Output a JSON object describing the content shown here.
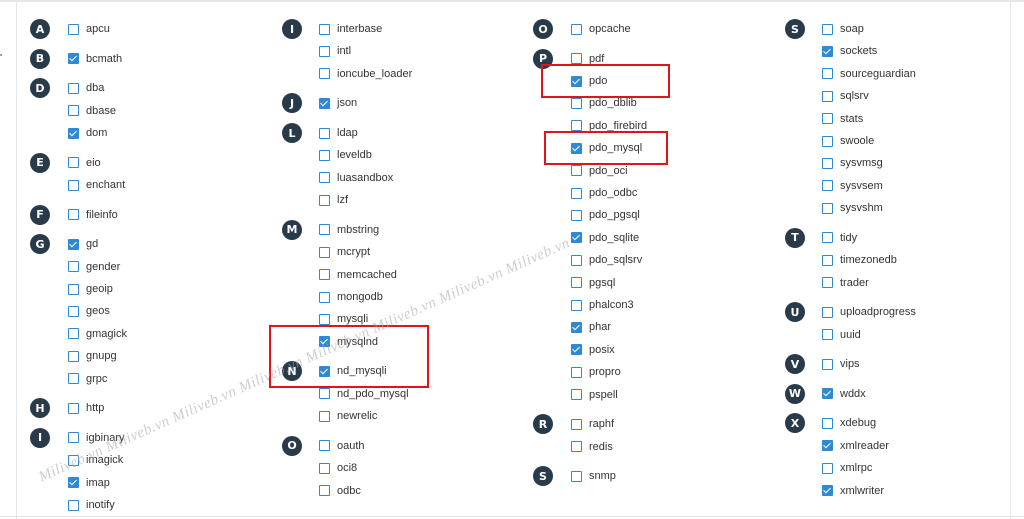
{
  "columns": [
    {
      "groups": [
        {
          "letter": "A",
          "items": [
            {
              "label": "apcu",
              "checked": false
            }
          ]
        },
        {
          "letter": "B",
          "items": [
            {
              "label": "bcmath",
              "checked": true
            }
          ]
        },
        {
          "letter": "D",
          "items": [
            {
              "label": "dba",
              "checked": false
            },
            {
              "label": "dbase",
              "checked": false
            },
            {
              "label": "dom",
              "checked": true
            }
          ]
        },
        {
          "letter": "E",
          "items": [
            {
              "label": "eio",
              "checked": false
            },
            {
              "label": "enchant",
              "checked": false
            }
          ]
        },
        {
          "letter": "F",
          "items": [
            {
              "label": "fileinfo",
              "checked": false
            }
          ]
        },
        {
          "letter": "G",
          "items": [
            {
              "label": "gd",
              "checked": true
            },
            {
              "label": "gender",
              "checked": false
            },
            {
              "label": "geoip",
              "checked": false
            },
            {
              "label": "geos",
              "checked": false
            },
            {
              "label": "gmagick",
              "checked": false
            },
            {
              "label": "gnupg",
              "checked": false
            },
            {
              "label": "grpc",
              "checked": false
            }
          ]
        },
        {
          "letter": "H",
          "items": [
            {
              "label": "http",
              "checked": false
            }
          ]
        },
        {
          "letter": "I",
          "items": [
            {
              "label": "igbinary",
              "checked": false
            },
            {
              "label": "imagick",
              "checked": false
            },
            {
              "label": "imap",
              "checked": true
            },
            {
              "label": "inotify",
              "checked": false
            }
          ]
        }
      ]
    },
    {
      "groups": [
        {
          "letter": "I",
          "items": [
            {
              "label": "interbase",
              "checked": false
            },
            {
              "label": "intl",
              "checked": false
            },
            {
              "label": "ioncube_loader",
              "checked": false
            }
          ]
        },
        {
          "letter": "J",
          "items": [
            {
              "label": "json",
              "checked": true
            }
          ]
        },
        {
          "letter": "L",
          "items": [
            {
              "label": "ldap",
              "checked": false
            },
            {
              "label": "leveldb",
              "checked": false
            },
            {
              "label": "luasandbox",
              "checked": false
            },
            {
              "label": "lzf",
              "checked": false
            }
          ]
        },
        {
          "letter": "M",
          "items": [
            {
              "label": "mbstring",
              "checked": false
            },
            {
              "label": "mcrypt",
              "checked": false
            },
            {
              "label": "memcached",
              "checked": false
            },
            {
              "label": "mongodb",
              "checked": false
            },
            {
              "label": "mysqli",
              "checked": false
            },
            {
              "label": "mysqlnd",
              "checked": true
            }
          ]
        },
        {
          "letter": "N",
          "items": [
            {
              "label": "nd_mysqli",
              "checked": true
            },
            {
              "label": "nd_pdo_mysql",
              "checked": false
            },
            {
              "label": "newrelic",
              "checked": false
            }
          ]
        },
        {
          "letter": "O",
          "items": [
            {
              "label": "oauth",
              "checked": false
            },
            {
              "label": "oci8",
              "checked": false
            },
            {
              "label": "odbc",
              "checked": false
            }
          ]
        }
      ]
    },
    {
      "groups": [
        {
          "letter": "O",
          "items": [
            {
              "label": "opcache",
              "checked": false
            }
          ]
        },
        {
          "letter": "P",
          "items": [
            {
              "label": "pdf",
              "checked": false
            },
            {
              "label": "pdo",
              "checked": true
            },
            {
              "label": "pdo_dblib",
              "checked": false
            },
            {
              "label": "pdo_firebird",
              "checked": false
            },
            {
              "label": "pdo_mysql",
              "checked": true
            },
            {
              "label": "pdo_oci",
              "checked": false
            },
            {
              "label": "pdo_odbc",
              "checked": false
            },
            {
              "label": "pdo_pgsql",
              "checked": false
            },
            {
              "label": "pdo_sqlite",
              "checked": true
            },
            {
              "label": "pdo_sqlsrv",
              "checked": false
            },
            {
              "label": "pgsql",
              "checked": false
            },
            {
              "label": "phalcon3",
              "checked": false
            },
            {
              "label": "phar",
              "checked": true
            },
            {
              "label": "posix",
              "checked": true
            },
            {
              "label": "propro",
              "checked": false
            },
            {
              "label": "pspell",
              "checked": false
            }
          ]
        },
        {
          "letter": "R",
          "items": [
            {
              "label": "raphf",
              "checked": false
            },
            {
              "label": "redis",
              "checked": false
            }
          ]
        },
        {
          "letter": "S",
          "items": [
            {
              "label": "snmp",
              "checked": false
            }
          ]
        }
      ]
    },
    {
      "groups": [
        {
          "letter": "S",
          "items": [
            {
              "label": "soap",
              "checked": false
            },
            {
              "label": "sockets",
              "checked": true
            },
            {
              "label": "sourceguardian",
              "checked": false
            },
            {
              "label": "sqlsrv",
              "checked": false
            },
            {
              "label": "stats",
              "checked": false
            },
            {
              "label": "swoole",
              "checked": false
            },
            {
              "label": "sysvmsg",
              "checked": false
            },
            {
              "label": "sysvsem",
              "checked": false
            },
            {
              "label": "sysvshm",
              "checked": false
            }
          ]
        },
        {
          "letter": "T",
          "items": [
            {
              "label": "tidy",
              "checked": false
            },
            {
              "label": "timezonedb",
              "checked": false
            },
            {
              "label": "trader",
              "checked": false
            }
          ]
        },
        {
          "letter": "U",
          "items": [
            {
              "label": "uploadprogress",
              "checked": false
            },
            {
              "label": "uuid",
              "checked": false
            }
          ]
        },
        {
          "letter": "V",
          "items": [
            {
              "label": "vips",
              "checked": false
            }
          ]
        },
        {
          "letter": "W",
          "items": [
            {
              "label": "wddx",
              "checked": true
            }
          ]
        },
        {
          "letter": "X",
          "items": [
            {
              "label": "xdebug",
              "checked": false
            },
            {
              "label": "xmlreader",
              "checked": true
            },
            {
              "label": "xmlrpc",
              "checked": false
            },
            {
              "label": "xmlwriter",
              "checked": true
            }
          ]
        }
      ]
    }
  ],
  "highlighted": [
    "pdo",
    "pdo_mysql",
    "mysqlnd",
    "nd_mysqli"
  ],
  "watermark": "Miliveb.vn Miliveb.vn Miliveb.vn Miliveb.vn Miliveb.vn Miliveb.vn Miliveb.vn Miliveb.vn",
  "colors": {
    "badge": "#293a4a",
    "checkbox": "#2f8ad6",
    "highlight": "#e0141e"
  }
}
